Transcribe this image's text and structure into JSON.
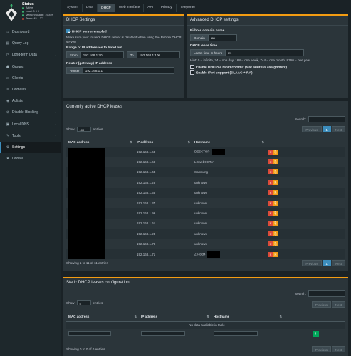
{
  "status": {
    "title": "Status",
    "active": "Active",
    "load": "Load:  0  0  0",
    "memory": "Memory usage:  19.8 %",
    "temp": "Temp: 45.1 °C"
  },
  "menu": [
    {
      "label": "Dashboard",
      "icon": "home-icon",
      "glyph": "⌂"
    },
    {
      "label": "Query Log",
      "icon": "file-icon",
      "glyph": "▤"
    },
    {
      "label": "Long-term Data",
      "icon": "clock-icon",
      "glyph": "◷",
      "chevron": true
    },
    {
      "label": "Groups",
      "icon": "users-icon",
      "glyph": "☗"
    },
    {
      "label": "Clients",
      "icon": "laptop-icon",
      "glyph": "▭"
    },
    {
      "label": "Domains",
      "icon": "list-icon",
      "glyph": "≡"
    },
    {
      "label": "Adlists",
      "icon": "shield-icon",
      "glyph": "◈"
    },
    {
      "label": "Disable Blocking",
      "icon": "stop-icon",
      "glyph": "⊘",
      "chevron": true
    },
    {
      "label": "Local DNS",
      "icon": "address-book-icon",
      "glyph": "▣",
      "chevron": true
    },
    {
      "label": "Tools",
      "icon": "wrench-icon",
      "glyph": "✎",
      "chevron": true
    },
    {
      "label": "Settings",
      "icon": "gear-icon",
      "glyph": "⚙",
      "active": true
    },
    {
      "label": "Donate",
      "icon": "paypal-icon",
      "glyph": "♥"
    }
  ],
  "tabs": [
    "System",
    "DNS",
    "DHCP",
    "Web interface",
    "API",
    "Privacy",
    "Teleporter"
  ],
  "active_tab": "DHCP",
  "dhcp_settings": {
    "title": "DHCP Settings",
    "enabled_label": "DHCP server enabled",
    "note": "Make sure your router's DHCP server is disabled when using the Pi-hole DHCP server!",
    "range_label": "Range of IP addresses to hand out",
    "from_label": "From",
    "from_value": "192.168.1.20",
    "to_label": "To",
    "to_value": "192.168.1.100",
    "router_section": "Router (gateway) IP address",
    "router_label": "Router",
    "router_value": "192.168.1.1"
  },
  "advanced": {
    "title": "Advanced DHCP settings",
    "domain_section": "Pi-hole domain name",
    "domain_label": "Domain",
    "domain_value": "lan",
    "lease_section": "DHCP lease time",
    "lease_label": "Lease time in hours",
    "lease_value": "24",
    "hint": "Hint: 0 = infinite, 24 = one day, 168 = one week, 744 = one month, 8760 = one year",
    "rapid_label": "Enable DHCPv4 rapid commit (fast address assignment)",
    "ipv6_label": "Enable IPv6 support (SLAAC + RA)"
  },
  "leases": {
    "title": "Currently active DHCP leases",
    "search_label": "Search:",
    "show_label": "Show",
    "show_value": "100",
    "entries_label": "entries",
    "columns": [
      "MAC address",
      "IP address",
      "Hostname"
    ],
    "rows": [
      {
        "ip": "192.168.1.63",
        "host": "DESKTOP-",
        "redact": true
      },
      {
        "ip": "192.168.1.68",
        "host": "LGwebOSTV",
        "redact": false
      },
      {
        "ip": "192.168.1.44",
        "host": "Samsung",
        "redact": false
      },
      {
        "ip": "192.168.1.28",
        "host": "unknown",
        "redact": false
      },
      {
        "ip": "192.168.1.55",
        "host": "unknown",
        "redact": false
      },
      {
        "ip": "192.168.1.37",
        "host": "unknown",
        "redact": false
      },
      {
        "ip": "192.168.1.99",
        "host": "unknown",
        "redact": false
      },
      {
        "ip": "192.168.1.61",
        "host": "unknown",
        "redact": false
      },
      {
        "ip": "192.168.1.23",
        "host": "unknown",
        "redact": false
      },
      {
        "ip": "192.168.1.78",
        "host": "unknown",
        "redact": false
      },
      {
        "ip": "192.168.1.71",
        "host": "Z-Fold4",
        "redact": true
      }
    ],
    "info": "Showing 1 to 11 of 11 entries",
    "prev": "Previous",
    "page": "1",
    "next": "Next"
  },
  "static": {
    "title": "Static DHCP leases configuration",
    "search_label": "Search:",
    "show_label": "Show",
    "show_value": "5",
    "entries_label": "entries",
    "columns": [
      "MAC address",
      "IP address",
      "Hostname"
    ],
    "empty": "No data available in table",
    "info": "Showing 0 to 0 of 0 entries",
    "prev": "Previous",
    "next": "Next",
    "add_glyph": "+"
  },
  "colors": {
    "accent": "#f39c12",
    "primary": "#3c8dbc",
    "danger": "#dd4b39",
    "success": "#00a65a"
  }
}
